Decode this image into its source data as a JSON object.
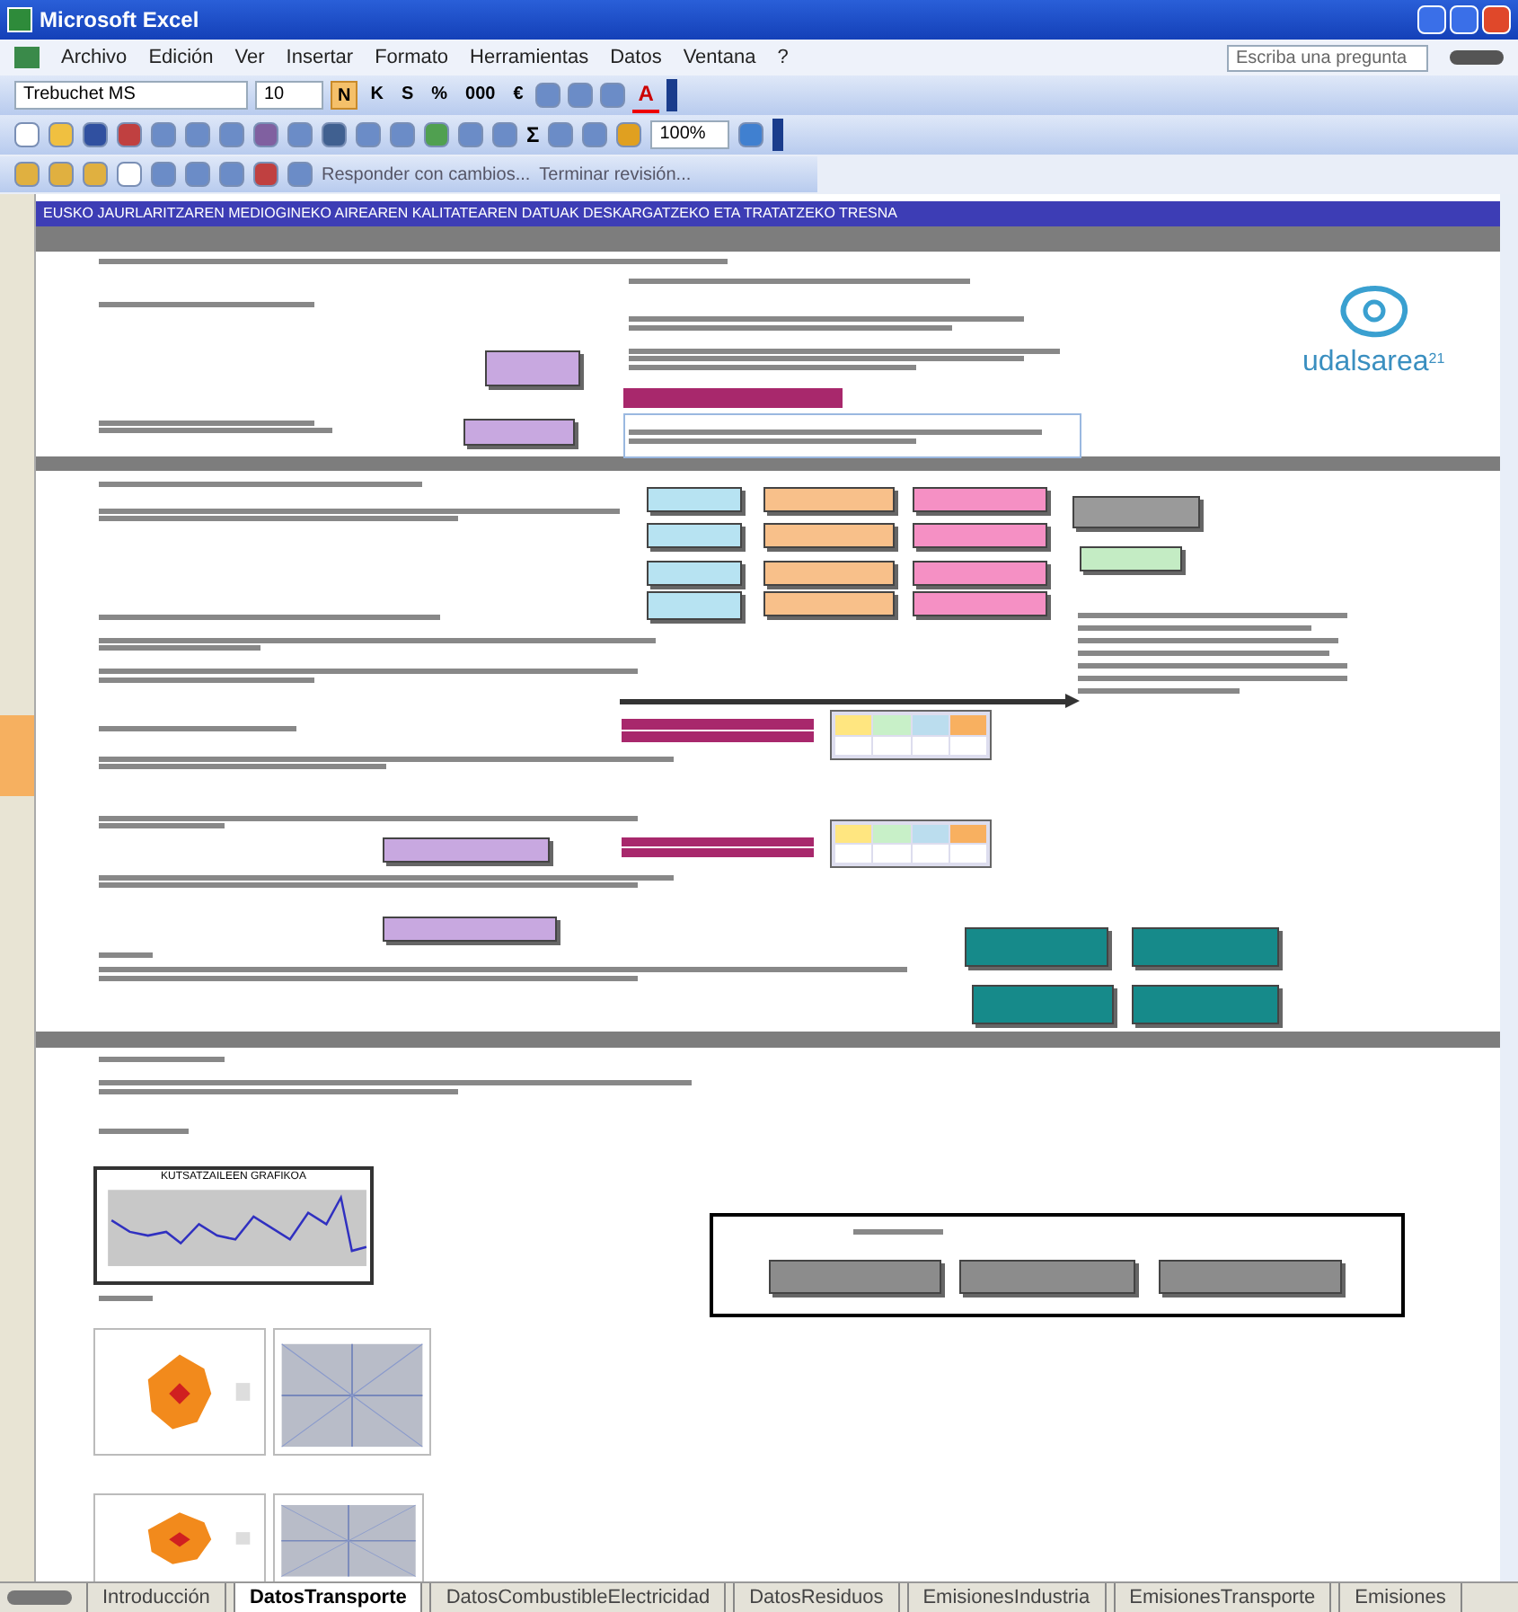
{
  "window": {
    "title": "Microsoft Excel"
  },
  "menu": [
    "Archivo",
    "Edición",
    "Ver",
    "Insertar",
    "Formato",
    "Herramientas",
    "Datos",
    "Ventana",
    "?"
  ],
  "help_search": {
    "placeholder": "Escriba una pregunta"
  },
  "format_toolbar": {
    "font": "Trebuchet MS",
    "size": "10",
    "buttons": [
      "N",
      "K",
      "S",
      "%",
      "000",
      "€"
    ],
    "font_color": "A"
  },
  "standard_toolbar": {
    "sum": "Σ",
    "zoom": "100%"
  },
  "review_toolbar": {
    "items": [
      "Responder con cambios...",
      "Terminar revisión..."
    ]
  },
  "sheet": {
    "title": "EUSKO JAURLARITZAREN MEDIOGINEKO AIREAREN KALITATEAREN DATUAK DESKARGATZEKO ETA TRATATZEKO TRESNA",
    "logo": "udalsarea",
    "logo_mark": "21",
    "chart_title": "KUTSATZAILEEN GRAFIKOA",
    "shapes": [
      {
        "kind": "box",
        "color": "#b7e3f2"
      },
      {
        "kind": "box",
        "color": "#b7e3f2"
      },
      {
        "kind": "box",
        "color": "#b7e3f2"
      },
      {
        "kind": "box",
        "color": "#b7e3f2"
      },
      {
        "kind": "box",
        "color": "#f8c08a"
      },
      {
        "kind": "box",
        "color": "#f8c08a"
      },
      {
        "kind": "box",
        "color": "#f8c08a"
      },
      {
        "kind": "box",
        "color": "#f8c08a"
      },
      {
        "kind": "box",
        "color": "#f590c4"
      },
      {
        "kind": "box",
        "color": "#f590c4"
      },
      {
        "kind": "box",
        "color": "#f590c4"
      },
      {
        "kind": "box",
        "color": "#f590c4"
      },
      {
        "kind": "box",
        "color": "#9a9a9a"
      },
      {
        "kind": "box",
        "color": "#c4ecc4"
      },
      {
        "kind": "box",
        "color": "#c8a8e0"
      },
      {
        "kind": "box",
        "color": "#c8a8e0"
      },
      {
        "kind": "box",
        "color": "#c8a8e0"
      },
      {
        "kind": "box",
        "color": "#c8a8e0"
      },
      {
        "kind": "bar",
        "color": "#a8286c"
      },
      {
        "kind": "bar",
        "color": "#a8286c"
      },
      {
        "kind": "bar",
        "color": "#a8286c"
      },
      {
        "kind": "bar",
        "color": "#a8286c"
      },
      {
        "kind": "bar",
        "color": "#a8286c"
      },
      {
        "kind": "box",
        "color": "#168a8a"
      },
      {
        "kind": "box",
        "color": "#168a8a"
      },
      {
        "kind": "box",
        "color": "#168a8a"
      },
      {
        "kind": "box",
        "color": "#168a8a"
      },
      {
        "kind": "box",
        "color": "#8c8c8c"
      },
      {
        "kind": "box",
        "color": "#8c8c8c"
      },
      {
        "kind": "box",
        "color": "#8c8c8c"
      }
    ]
  },
  "sheet_tabs": [
    {
      "label": "Introducción",
      "selected": false
    },
    {
      "label": "DatosTransporte",
      "selected": true
    },
    {
      "label": "DatosCombustibleElectricidad",
      "selected": false
    },
    {
      "label": "DatosResiduos",
      "selected": false
    },
    {
      "label": "EmisionesIndustria",
      "selected": false
    },
    {
      "label": "EmisionesTransporte",
      "selected": false
    },
    {
      "label": "Emisiones",
      "selected": false
    }
  ]
}
